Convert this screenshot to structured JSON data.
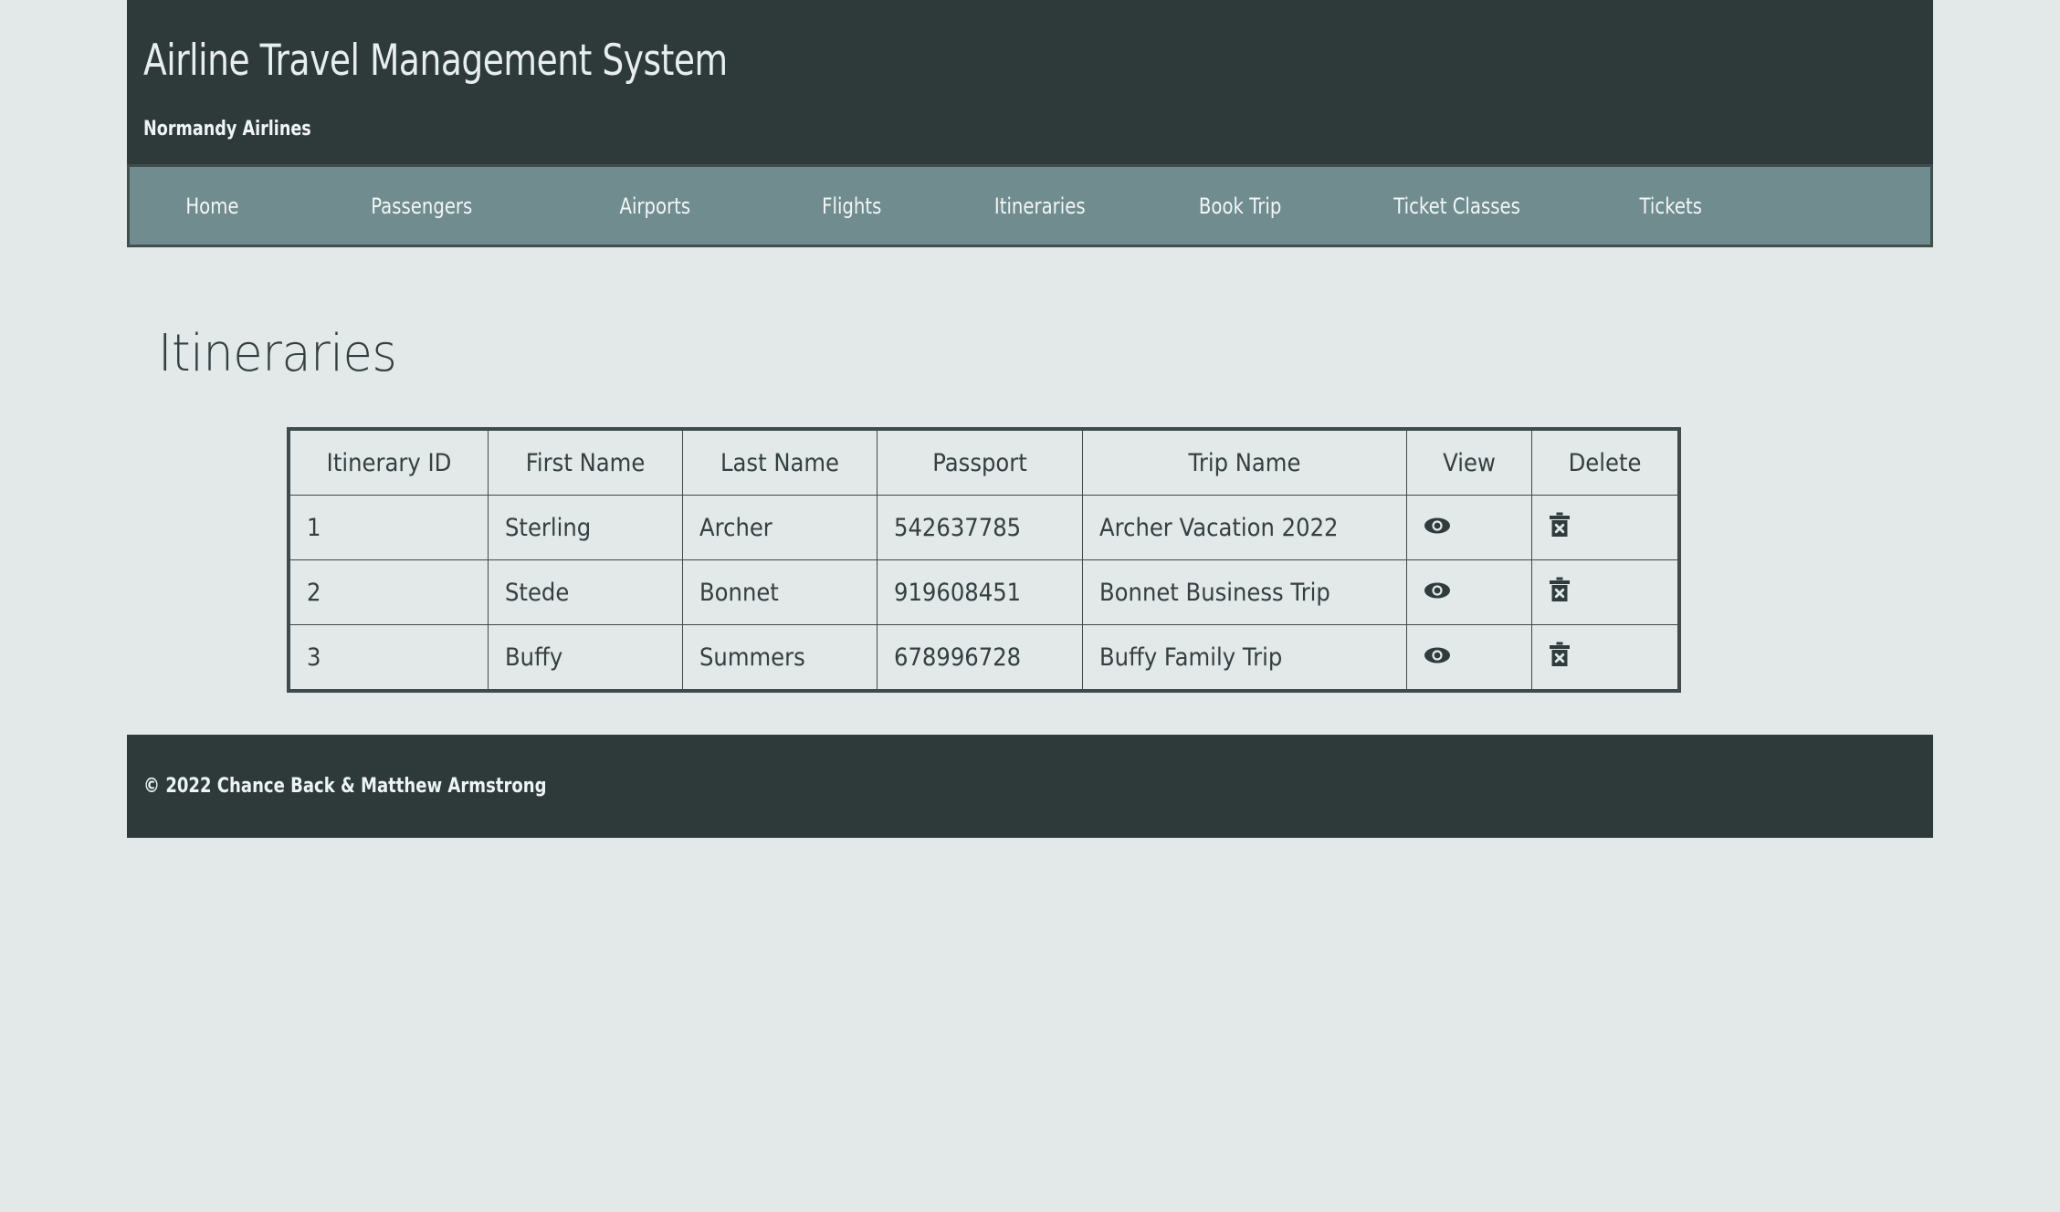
{
  "header": {
    "title": "Airline Travel Management System",
    "subtitle": "Normandy Airlines"
  },
  "nav": {
    "items": [
      {
        "label": "Home",
        "name": "nav-item-home"
      },
      {
        "label": "Passengers",
        "name": "nav-item-passengers"
      },
      {
        "label": "Airports",
        "name": "nav-item-airports"
      },
      {
        "label": "Flights",
        "name": "nav-item-flights"
      },
      {
        "label": "Itineraries",
        "name": "nav-item-itineraries"
      },
      {
        "label": "Book Trip",
        "name": "nav-item-book-trip"
      },
      {
        "label": "Ticket Classes",
        "name": "nav-item-ticket-classes"
      },
      {
        "label": "Tickets",
        "name": "nav-item-tickets"
      }
    ]
  },
  "main": {
    "page_title": "Itineraries",
    "table": {
      "columns": [
        "Itinerary ID",
        "First Name",
        "Last Name",
        "Passport",
        "Trip Name",
        "View",
        "Delete"
      ],
      "rows": [
        {
          "itinerary_id": "1",
          "first_name": "Sterling",
          "last_name": "Archer",
          "passport": "542637785",
          "trip_name": "Archer Vacation 2022",
          "view_icon": "eye-icon",
          "delete_icon": "trash-x-icon"
        },
        {
          "itinerary_id": "2",
          "first_name": "Stede",
          "last_name": "Bonnet",
          "passport": "919608451",
          "trip_name": "Bonnet Business Trip",
          "view_icon": "eye-icon",
          "delete_icon": "trash-x-icon"
        },
        {
          "itinerary_id": "3",
          "first_name": "Buffy",
          "last_name": "Summers",
          "passport": "678996728",
          "trip_name": "Buffy Family Trip",
          "view_icon": "eye-icon",
          "delete_icon": "trash-x-icon"
        }
      ]
    }
  },
  "footer": {
    "text": "© 2022 Chance Back & Matthew Armstrong"
  },
  "colors": {
    "header_bg": "#2e3a3a",
    "nav_bg": "#718c8e",
    "nav_border": "#414e4e",
    "page_bg": "#e3e8e8",
    "text_dark": "#333f40",
    "table_border": "#3e4a4b",
    "footer_bg": "#2e3a3a"
  }
}
